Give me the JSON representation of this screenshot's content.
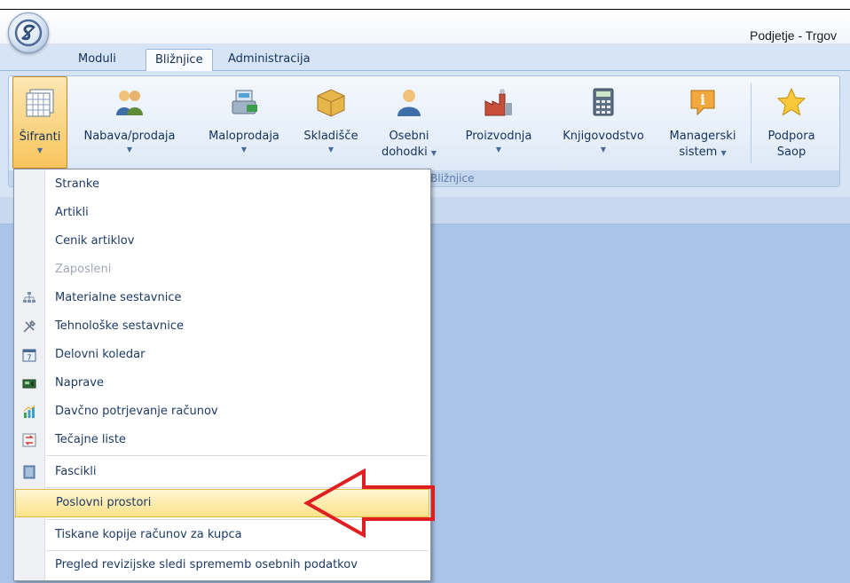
{
  "app": {
    "title": "Podjetje - Trgov"
  },
  "tabs": [
    {
      "label": "Moduli"
    },
    {
      "label": "Bližnjice"
    },
    {
      "label": "Administracija"
    }
  ],
  "ribbon": {
    "group_label": "Bližnjice",
    "buttons": [
      {
        "line1": "Šifranti",
        "line2": "",
        "icon": "grid-icon"
      },
      {
        "line1": "Nabava/prodaja",
        "line2": "",
        "icon": "people-icon"
      },
      {
        "line1": "Maloprodaja",
        "line2": "",
        "icon": "cash-register-icon"
      },
      {
        "line1": "Skladišče",
        "line2": "",
        "icon": "boxes-icon"
      },
      {
        "line1": "Osebni",
        "line2": "dohodki",
        "icon": "person-icon"
      },
      {
        "line1": "Proizvodnja",
        "line2": "",
        "icon": "factory-icon"
      },
      {
        "line1": "Knjigovodstvo",
        "line2": "",
        "icon": "calculator-icon"
      },
      {
        "line1": "Managerski",
        "line2": "sistem",
        "icon": "info-icon"
      },
      {
        "line1": "Podpora",
        "line2": "Saop",
        "icon": "star-icon"
      }
    ]
  },
  "menu": {
    "items": [
      {
        "label": "Stranke",
        "icon": ""
      },
      {
        "label": "Artikli",
        "icon": ""
      },
      {
        "label": "Cenik artiklov",
        "icon": ""
      },
      {
        "label": "Zaposleni",
        "icon": "",
        "disabled": true
      },
      {
        "label": "Materialne sestavnice",
        "icon": "hierarchy-icon"
      },
      {
        "label": "Tehnološke sestavnice",
        "icon": "tools-icon"
      },
      {
        "label": "Delovni koledar",
        "icon": "calendar-icon"
      },
      {
        "label": "Naprave",
        "icon": "device-icon"
      },
      {
        "label": "Davčno potrjevanje računov",
        "icon": "bar-chart-icon"
      },
      {
        "label": "Tečajne liste",
        "icon": "exchange-icon"
      },
      {
        "label": "Fascikli",
        "icon": "folder-icon"
      },
      {
        "label": "Poslovni prostori",
        "icon": "",
        "highlighted": true
      },
      {
        "label": "Tiskane kopije računov za kupca",
        "icon": ""
      },
      {
        "label": "Pregled revizijske sledi sprememb osebnih podatkov",
        "icon": ""
      }
    ]
  },
  "colors": {
    "accent": "#f7c55c",
    "arrow": "#e02020",
    "background": "#a9c4e8"
  }
}
